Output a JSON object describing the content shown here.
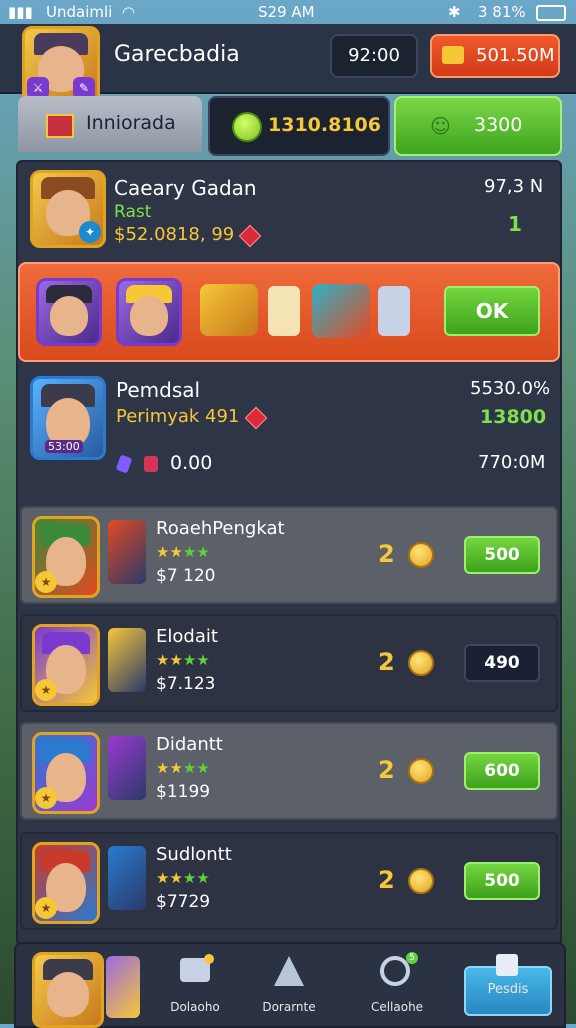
{
  "status_bar": {
    "carrier": "Undaimli",
    "time": "S29 AM",
    "battery": "3 81%"
  },
  "header": {
    "title": "Garecbadia",
    "currency_dark": "92:00",
    "currency_red": "501.50M"
  },
  "tabs": {
    "active_label": "Inniorada",
    "gold_amount": "1310.8106",
    "green_amount": "3300"
  },
  "top_card": {
    "name": "Caeary Gadan",
    "sub": "Rast",
    "price": "$52.0818, 99",
    "right_value": "97,3 N",
    "right_sub": "1"
  },
  "hero_bar": {
    "ok_label": "OK"
  },
  "card2": {
    "name": "Pemdsal",
    "sub": "Perimyak 491",
    "badge": "53:00",
    "right_value": "5530.0%",
    "right_sub": "13800",
    "gems_value": "0.00",
    "right_bottom": "770:0M"
  },
  "rows": [
    {
      "title": "RoaehPengkat",
      "price": "$7 120",
      "count": "2",
      "button": "500",
      "style": "light",
      "btn": "green"
    },
    {
      "title": "Elodait",
      "price": "$7.123",
      "count": "2",
      "button": "490",
      "style": "dark",
      "btn": "dark"
    },
    {
      "title": "Didantt",
      "price": "$1199",
      "count": "2",
      "button": "600",
      "style": "light",
      "btn": "green"
    },
    {
      "title": "Sudlontt",
      "price": "$7729",
      "count": "2",
      "button": "500",
      "style": "dark",
      "btn": "green"
    }
  ],
  "nav": {
    "item1": "Dolaoho",
    "item2": "Dorarnte",
    "item3": "Cellaohe",
    "item4": "Pesdis",
    "badge": "5"
  },
  "colors": {
    "accent_green": "#5cc22e",
    "accent_red": "#e24a22",
    "gold": "#f6c737",
    "panel": "#2e3547"
  }
}
